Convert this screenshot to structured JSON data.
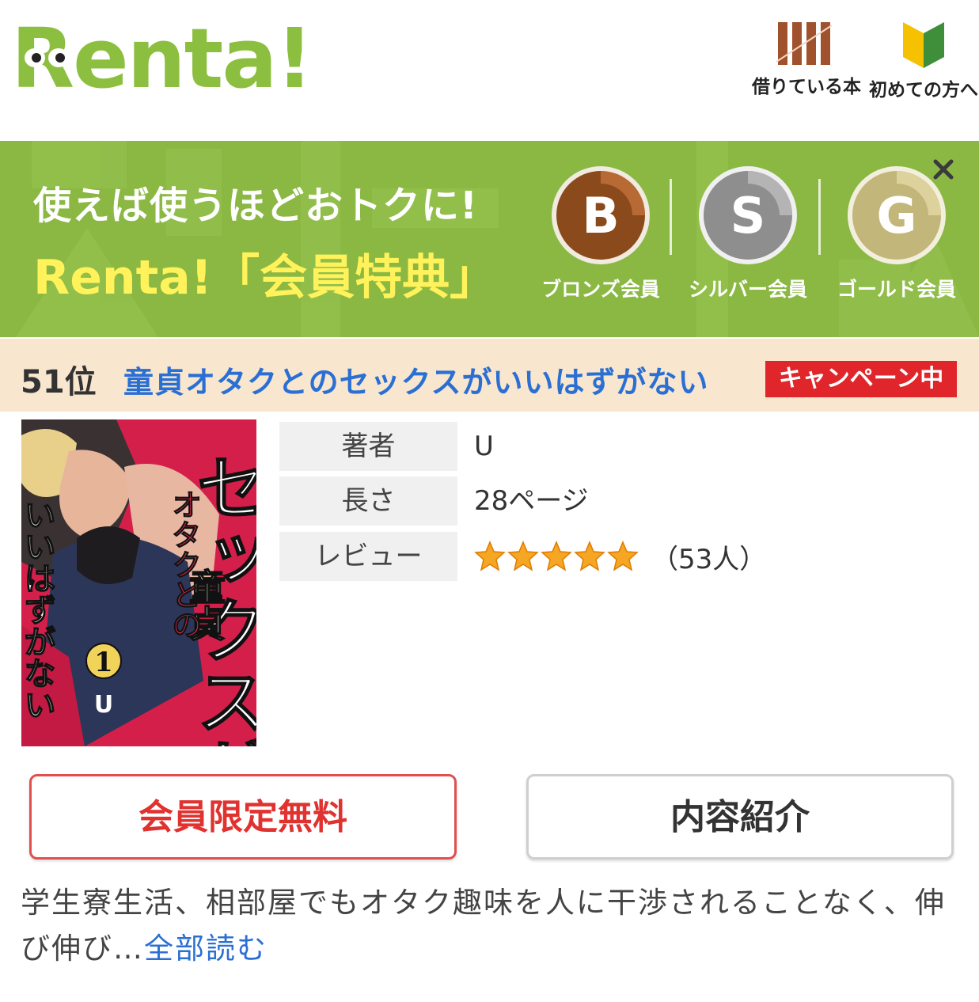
{
  "header": {
    "logo_text": "Renta!",
    "nav": [
      {
        "label": "借りている本",
        "icon": "bookshelf-icon"
      },
      {
        "label": "初めての方へ",
        "icon": "beginner-mark-icon"
      }
    ]
  },
  "banner": {
    "line1": "使えば使うほどおトクに!",
    "line2": "Renta!「会員特典」",
    "medals": [
      {
        "letter": "B",
        "label": "ブロンズ会員",
        "color": "#8a4a1c"
      },
      {
        "letter": "S",
        "label": "シルバー会員",
        "color": "#8e8e8e"
      },
      {
        "letter": "G",
        "label": "ゴールド会員",
        "color": "#c3b67a"
      }
    ],
    "close_symbol": "×",
    "colors": {
      "background": "#8ab843",
      "highlight_text": "#fff25a"
    }
  },
  "rank_bar": {
    "rank": "51位",
    "title": "童貞オタクとのセックスがいいはずがない",
    "badge": "キャンペーン中"
  },
  "cover": {
    "title_vertical_1": "童貞",
    "title_vertical_2": "オタクとの",
    "title_vertical_3": "セックスが",
    "title_vertical_4": "いいはずがない",
    "volume": "1",
    "author_mark": "U"
  },
  "info": {
    "rows": [
      {
        "key": "著者",
        "value": "U"
      },
      {
        "key": "長さ",
        "value": "28ページ"
      },
      {
        "key": "レビュー",
        "value": "（53人）"
      }
    ],
    "rating": 5,
    "rating_max": 5
  },
  "buttons": {
    "free_label": "会員限定無料",
    "intro_label": "内容紹介"
  },
  "description": {
    "text": "学生寮生活、相部屋でもオタク趣味を人に干渉されることなく、伸び伸び…",
    "more_link": "全部読む"
  }
}
